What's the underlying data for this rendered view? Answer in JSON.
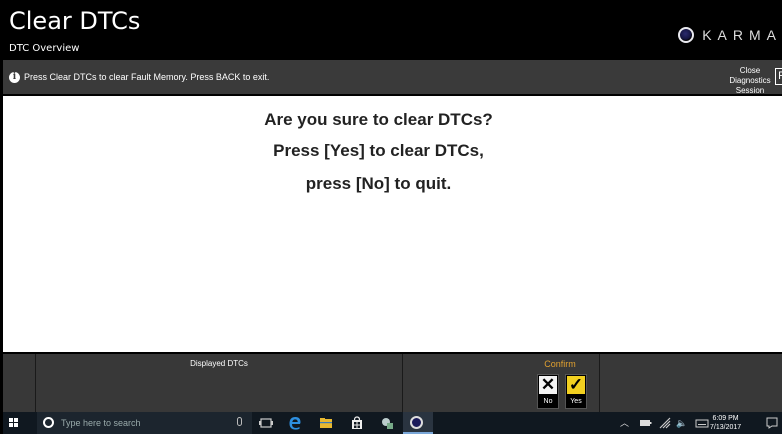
{
  "header": {
    "title": "Clear DTCs",
    "subtitle": "DTC Overview",
    "brand": "KARMA"
  },
  "infobar": {
    "message": "Press Clear DTCs to clear Fault Memory. Press BACK to exit.",
    "close_label_line1": "Close Diagnostics",
    "close_label_line2": "Session",
    "exit_glyph": "F"
  },
  "main": {
    "line1": "Are you sure to clear DTCs?",
    "line2": "Press [Yes] to clear DTCs,",
    "line3": "press [No] to quit."
  },
  "toolbar": {
    "displayed_label": "Displayed DTCs",
    "confirm_label": "Confirm",
    "no_label": "No",
    "yes_label": "Yes",
    "no_glyph": "✕",
    "yes_glyph": "✓"
  },
  "taskbar": {
    "search_placeholder": "Type here to search",
    "time": "6:09 PM",
    "date": "7/13/2017"
  },
  "colors": {
    "confirm_accent": "#e0a030",
    "yes_button": "#f2d020",
    "infobar_bg": "#3a3a3a",
    "toolbar_bg": "#383838"
  }
}
